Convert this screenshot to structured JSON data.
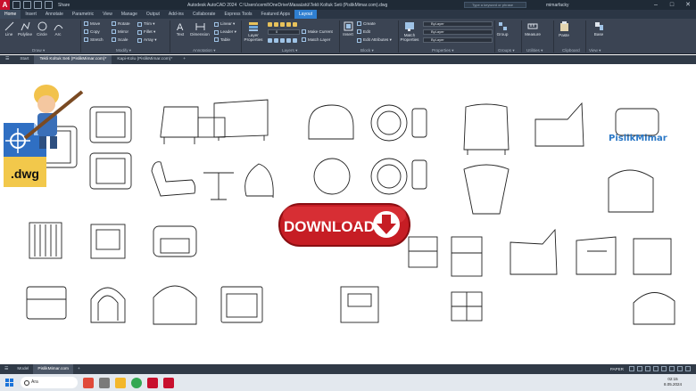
{
  "titlebar": {
    "app_name": "Autodesk AutoCAD 2024",
    "file_path": "C:\\Users\\cemil\\OneDrive\\Masaüstü\\Tekli Koltuk Seti (PislikMimar.com).dwg",
    "share_label": "Share",
    "search_placeholder": "Type a keyword or phrase",
    "user": "mimarfacky",
    "minimize": "–",
    "maximize": "□",
    "close": "✕"
  },
  "ribbon_tabs": [
    "Home",
    "Insert",
    "Annotate",
    "Parametric",
    "View",
    "Manage",
    "Output",
    "Add-ins",
    "Collaborate",
    "Express Tools",
    "Featured Apps",
    "Layout"
  ],
  "ribbon": {
    "draw": {
      "line": "Line",
      "polyline": "Polyline",
      "circle": "Circle",
      "arc": "Arc",
      "panel": "Draw ▾"
    },
    "modify": {
      "move": "Move",
      "rotate": "Rotate",
      "trim": "Trim ▾",
      "copy": "Copy",
      "mirror": "Mirror",
      "fillet": "Fillet ▾",
      "stretch": "Stretch",
      "scale": "Scale",
      "array": "Array ▾",
      "panel": "Modify ▾"
    },
    "annotation": {
      "text": "Text",
      "dimension": "Dimension",
      "linear": "Linear ▾",
      "leader": "Leader ▾",
      "table": "Table",
      "panel": "Annotation ▾"
    },
    "layers": {
      "layer_properties": "Layer Properties",
      "make_current": "Make Current",
      "match_layer": "Match Layer",
      "current_layer": "0",
      "panel": "Layers ▾"
    },
    "block": {
      "insert": "Insert",
      "create": "Create",
      "edit": "Edit",
      "edit_attributes": "Edit Attributes ▾",
      "panel": "Block ▾"
    },
    "properties": {
      "match_properties": "Match Properties",
      "color": "ByLayer",
      "linetype": "ByLayer",
      "lineweight": "ByLayer",
      "panel": "Properties ▾"
    },
    "groups": {
      "group": "Group",
      "panel": "Groups ▾"
    },
    "utilities": {
      "measure": "Measure",
      "panel": "Utilities ▾"
    },
    "clipboard": {
      "paste": "Paste",
      "panel": "Clipboard"
    },
    "view": {
      "base": "Base",
      "panel": "View ▾"
    }
  },
  "doc_tabs": [
    "Start",
    "Tekli Koltuk Seti (PislikMimar.com)*",
    "Kapi-Kolu (PislikMimar.com)*",
    "+"
  ],
  "overlays": {
    "dwg_label": ".dwg",
    "download_label": "DOWNLOAD",
    "watermark": "PislikMimar"
  },
  "layout_tabs": [
    "Model",
    "PislikMimar.com",
    "+"
  ],
  "status_bar": {
    "space": "PAPER"
  },
  "taskbar": {
    "search": "Ara",
    "time": "02:15",
    "date": "8.05.2024"
  }
}
